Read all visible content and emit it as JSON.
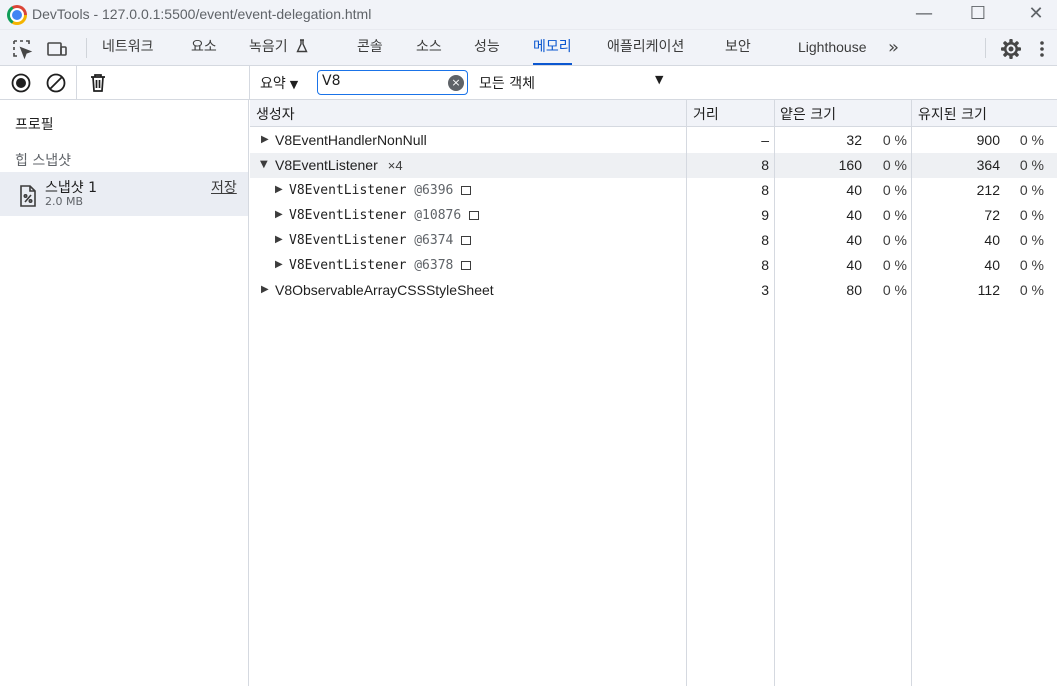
{
  "window": {
    "title": "DevTools - 127.0.0.1:5500/event/event-delegation.html",
    "minimize": "—",
    "maximize": "☐",
    "close": "✕"
  },
  "tabs": [
    {
      "label": "네트워크"
    },
    {
      "label": "요소"
    },
    {
      "label": "녹음기"
    },
    {
      "label": "콘솔"
    },
    {
      "label": "소스"
    },
    {
      "label": "성능"
    },
    {
      "label": "메모리",
      "active": true
    },
    {
      "label": "애플리케이션"
    },
    {
      "label": "보안"
    },
    {
      "label": "Lighthouse"
    }
  ],
  "more_tabs": "»",
  "toolbar": {
    "view_select": "요약",
    "filter_value": "V8",
    "clear_label": "×",
    "object_filter": "모든 객체"
  },
  "sidebar": {
    "profiles_title": "프로필",
    "heap_section": "힙 스냅샷",
    "snapshot": {
      "name": "스냅샷 1",
      "size": "2.0 MB",
      "save": "저장"
    }
  },
  "grid": {
    "headers": {
      "constructor": "생성자",
      "distance": "거리",
      "shallow": "얕은 크기",
      "retained": "유지된 크기"
    },
    "rows": [
      {
        "name": "V8EventHandlerNonNull",
        "distance": "–",
        "shallow": "32",
        "shallow_pct": "0 %",
        "retained": "900",
        "retained_pct": "0 %"
      },
      {
        "name": "V8EventListener",
        "count": "×4",
        "distance": "8",
        "shallow": "160",
        "shallow_pct": "0 %",
        "retained": "364",
        "retained_pct": "0 %"
      },
      {
        "name": "V8EventListener",
        "id": "@6396",
        "distance": "8",
        "shallow": "40",
        "shallow_pct": "0 %",
        "retained": "212",
        "retained_pct": "0 %"
      },
      {
        "name": "V8EventListener",
        "id": "@10876",
        "distance": "9",
        "shallow": "40",
        "shallow_pct": "0 %",
        "retained": "72",
        "retained_pct": "0 %"
      },
      {
        "name": "V8EventListener",
        "id": "@6374",
        "distance": "8",
        "shallow": "40",
        "shallow_pct": "0 %",
        "retained": "40",
        "retained_pct": "0 %"
      },
      {
        "name": "V8EventListener",
        "id": "@6378",
        "distance": "8",
        "shallow": "40",
        "shallow_pct": "0 %",
        "retained": "40",
        "retained_pct": "0 %"
      },
      {
        "name": "V8ObservableArrayCSSStyleSheet",
        "distance": "3",
        "shallow": "80",
        "shallow_pct": "0 %",
        "retained": "112",
        "retained_pct": "0 %"
      }
    ]
  },
  "icons": {
    "inspect": "inspect-element-icon",
    "device": "device-toolbar-icon",
    "recorder": "flask-icon",
    "settings": "gear-icon",
    "menu": "kebab-menu-icon",
    "record": "record-icon",
    "clear": "clear-icon",
    "gc": "trash-icon",
    "snapshot": "heap-snapshot-file-icon"
  },
  "colors": {
    "accent": "#0b57d0",
    "selected_row": "#eef0f3",
    "panel_bg": "#f1f3f8"
  }
}
